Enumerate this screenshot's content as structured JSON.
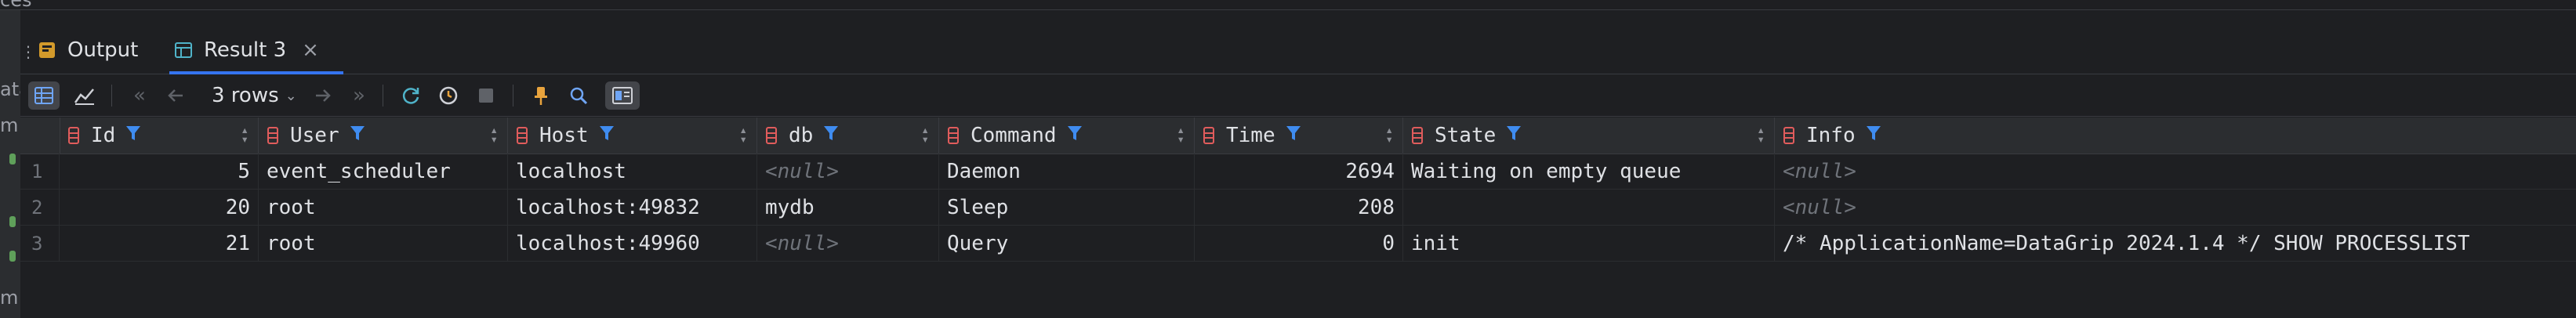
{
  "top_cut_text": "ces",
  "left_strip": [
    "ata",
    "m",
    "m"
  ],
  "tabs": [
    {
      "label": "Output",
      "active": false
    },
    {
      "label": "Result 3",
      "active": true
    }
  ],
  "tab_close_glyph": "×",
  "toolbar": {
    "rows_label": "3 rows"
  },
  "columns": [
    "Id",
    "User",
    "Host",
    "db",
    "Command",
    "Time",
    "State",
    "Info"
  ],
  "rows": [
    {
      "n": "1",
      "id": "5",
      "user": "event_scheduler",
      "host": "localhost",
      "db": "<null>",
      "command": "Daemon",
      "time": "2694",
      "state": "Waiting on empty queue",
      "info": "<null>"
    },
    {
      "n": "2",
      "id": "20",
      "user": "root",
      "host": "localhost:49832",
      "db": "mydb",
      "command": "Sleep",
      "time": "208",
      "state": "",
      "info": "<null>"
    },
    {
      "n": "3",
      "id": "21",
      "user": "root",
      "host": "localhost:49960",
      "db": "<null>",
      "command": "Query",
      "time": "0",
      "state": "init",
      "info": "/* ApplicationName=DataGrip 2024.1.4 */ SHOW PROCESSLIST"
    }
  ],
  "colors": {
    "accent": "#3574f0",
    "background": "#1e1f22",
    "null_text": "#6f737a"
  }
}
